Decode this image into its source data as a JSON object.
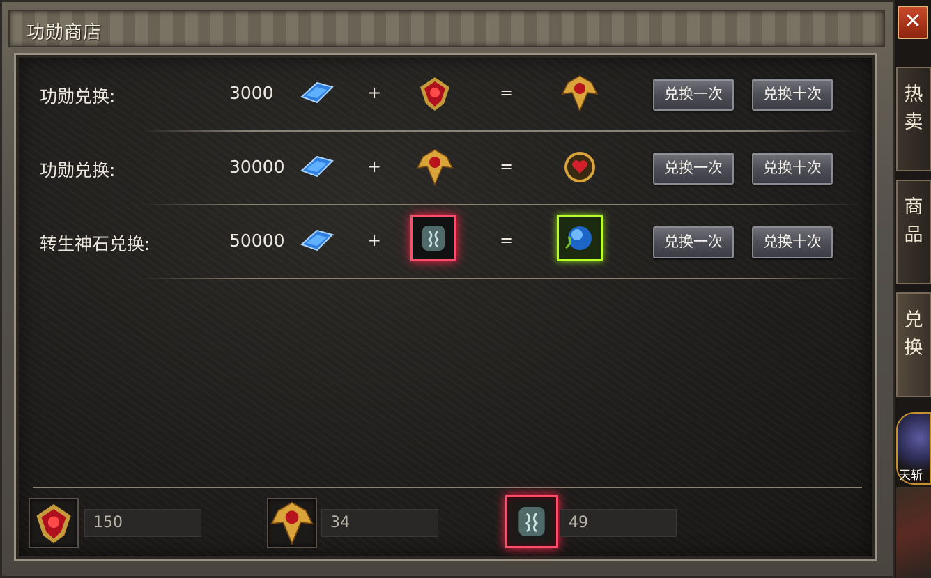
{
  "window": {
    "title": "功勋商店",
    "close_label": "✕"
  },
  "rows": [
    {
      "label": "功勋兑换:",
      "cost": "3000",
      "plus": "+",
      "equals": "=",
      "input_icon": "red-medal-icon",
      "output_icon": "gold-winged-medal-icon",
      "btn_once": "兑换一次",
      "btn_ten": "兑换十次"
    },
    {
      "label": "功勋兑换:",
      "cost": "30000",
      "plus": "+",
      "equals": "=",
      "input_icon": "gold-winged-medal-icon",
      "output_icon": "round-heart-medal-icon",
      "btn_once": "兑换一次",
      "btn_ten": "兑换十次"
    },
    {
      "label": "转生神石兑换:",
      "cost": "50000",
      "plus": "+",
      "equals": "=",
      "input_icon": "rebirth-stone-icon",
      "output_icon": "blue-orb-icon",
      "btn_once": "兑换一次",
      "btn_ten": "兑换十次"
    }
  ],
  "currency_icon": "blue-crystal-icon",
  "inventory": [
    {
      "icon": "red-medal-icon",
      "count": "150"
    },
    {
      "icon": "gold-winged-medal-icon",
      "count": "34"
    },
    {
      "icon": "rebirth-stone-icon",
      "count": "49"
    }
  ],
  "side_tabs": [
    {
      "label_top": "热",
      "label_bottom": "卖"
    },
    {
      "label_top": "商",
      "label_bottom": "品"
    },
    {
      "label_top": "兑",
      "label_bottom": "换"
    }
  ],
  "skill": {
    "label": "天斩"
  },
  "colors": {
    "text": "#ece8e0",
    "glow_red": "#ff2248",
    "glow_green": "#b6ff2a",
    "crystal_blue": "#3a8ee8"
  }
}
